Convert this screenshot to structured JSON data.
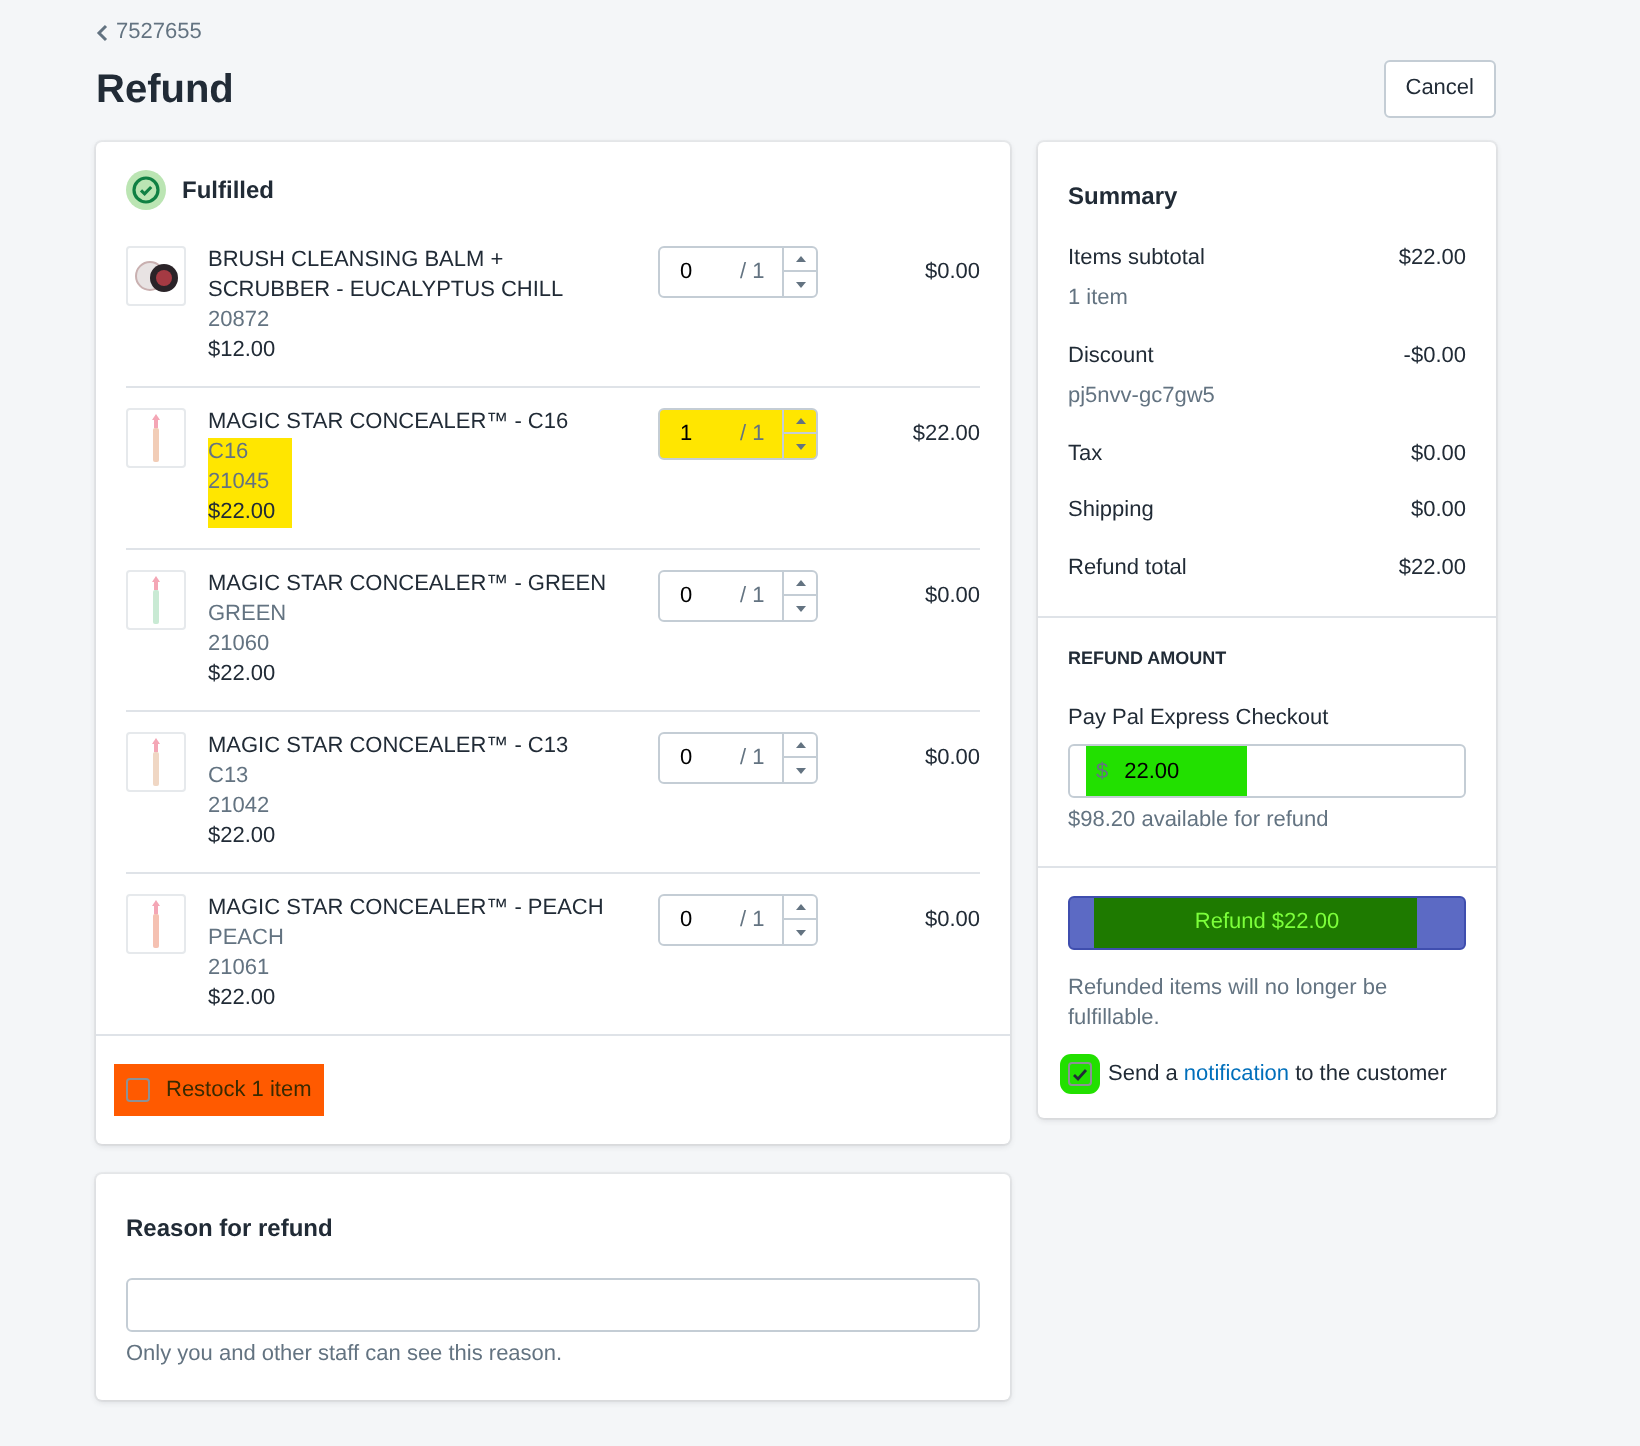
{
  "breadcrumb": {
    "label": "7527655"
  },
  "title": "Refund",
  "cancel_button": "Cancel",
  "fulfillment": {
    "status": "Fulfilled",
    "items": [
      {
        "name": "BRUSH CLEANSING BALM + SCRUBBER - EUCALYPTUS CHILL",
        "kind": "balm",
        "sku": "20872",
        "price": "$12.00",
        "quantity": "0",
        "max": "/ 1",
        "amount": "$0.00"
      },
      {
        "name": "MAGIC STAR CONCEALER™ - C16",
        "kind": "concealer",
        "variant": "C16",
        "sku": "21045",
        "price": "$22.00",
        "quantity": "1",
        "max": "/ 1",
        "amount": "$22.00",
        "color": "#ffe600"
      },
      {
        "name": "MAGIC STAR CONCEALER™ - GREEN",
        "kind": "concealer",
        "variant": "GREEN",
        "sku": "21060",
        "price": "$22.00",
        "quantity": "0",
        "max": "/ 1",
        "amount": "$0.00"
      },
      {
        "name": "MAGIC STAR CONCEALER™ - C13",
        "kind": "concealer",
        "variant": "C13",
        "sku": "21042",
        "price": "$22.00",
        "quantity": "0",
        "max": "/ 1",
        "amount": "$0.00"
      },
      {
        "name": "MAGIC STAR CONCEALER™ - PEACH",
        "kind": "concealer",
        "variant": "PEACH",
        "sku": "21061",
        "price": "$22.00",
        "quantity": "0",
        "max": "/ 1",
        "amount": "$0.00"
      }
    ],
    "restock": {
      "label": "Restock 1 item",
      "checked": false,
      "color": "#ff5a00"
    }
  },
  "reason": {
    "title": "Reason for refund",
    "help": "Only you and other staff can see this reason."
  },
  "summary": {
    "title": "Summary",
    "rows": [
      {
        "label": "Items subtotal",
        "value": "$22.00",
        "note": "1 item"
      },
      {
        "label": "Discount",
        "value": "-$0.00",
        "note": "pj5nvv-gc7gw5"
      },
      {
        "label": "Tax",
        "value": "$0.00"
      },
      {
        "label": "Shipping",
        "value": "$0.00"
      },
      {
        "label": "Refund total",
        "value": "$22.00"
      }
    ]
  },
  "refund_amount": {
    "heading": "REFUND AMOUNT",
    "method": "Pay Pal Express Checkout",
    "currency": "$",
    "value": "22.00",
    "available": "$98.20 available for refund",
    "color": "#22e000"
  },
  "refund_button": {
    "label": "Refund $22.00",
    "color": "#1e7a00"
  },
  "warning": "Refunded items will no longer be fulfillable.",
  "notify": {
    "checked": true,
    "before": "Send a",
    "link": "notification",
    "after": "to the customer",
    "color": "#22e000"
  }
}
